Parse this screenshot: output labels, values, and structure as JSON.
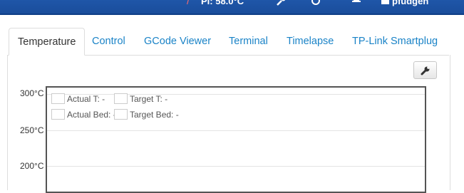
{
  "navbar": {
    "temp_readout": "PI: 58.0°C",
    "user": "pfudgen"
  },
  "tabs": [
    "Temperature",
    "Control",
    "GCode Viewer",
    "Terminal",
    "Timelapse",
    "TP-Link Smartplug"
  ],
  "chart": {
    "y_ticks": [
      "300°C",
      "250°C",
      "200°C"
    ],
    "legend": [
      {
        "label": "Actual T: -",
        "color": "#ee0000"
      },
      {
        "label": "Target T: -",
        "color": "#ff8888"
      },
      {
        "label": "Actual Bed: -",
        "color": "#0000dd"
      },
      {
        "label": "Target Bed: -",
        "color": "#8888ff"
      }
    ]
  }
}
